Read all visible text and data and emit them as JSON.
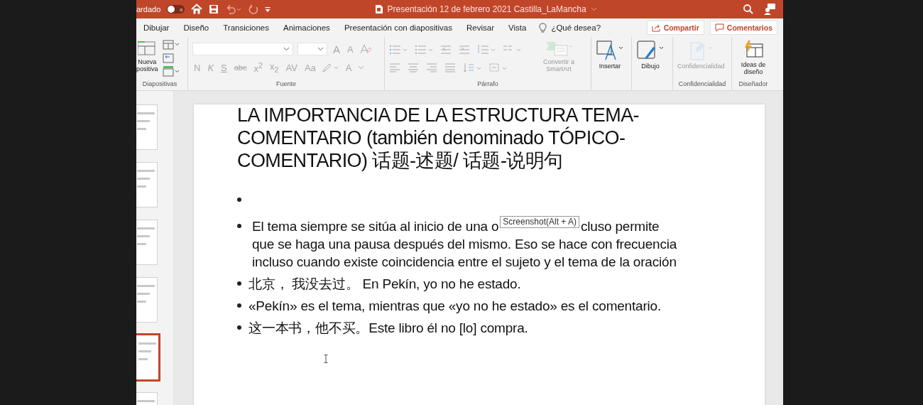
{
  "title_bar": {
    "autosave_label": "ardado",
    "autosave_on": false,
    "autosave_knob": "o",
    "document_title": "Presentación 12 de febrero 2021 Castilla_LaMancha"
  },
  "tabs": [
    {
      "label": "Dibujar",
      "selected": false
    },
    {
      "label": "Diseño",
      "selected": false
    },
    {
      "label": "Transiciones",
      "selected": false
    },
    {
      "label": "Animaciones",
      "selected": false
    },
    {
      "label": "Presentación con diapositivas",
      "selected": false
    },
    {
      "label": "Revisar",
      "selected": false
    },
    {
      "label": "Vista",
      "selected": false
    }
  ],
  "tell_me": {
    "placeholder": "¿Qué desea?"
  },
  "share_button": "Compartir",
  "comments_button": "Comentarios",
  "ribbon": {
    "slides_group": {
      "new_slide": [
        "Nueva",
        "positiva"
      ],
      "label": "Diapositivas"
    },
    "font_group": {
      "format_buttons": [
        "N",
        "K",
        "S",
        "abc",
        "x$^{2}$",
        "x$_{2}$",
        "AV",
        "Aa"
      ],
      "grow": "A",
      "shrink": "A",
      "font_color": "A",
      "label": "Fuente"
    },
    "paragraph_group": {
      "label": "Párrafo",
      "smartart": "Convertir a SmartArt"
    },
    "insert": "Insertar",
    "drawing": "Dibujo",
    "sensitivity": {
      "button": "Confidencialidad",
      "label": "Confidencialidad",
      "disabled": true
    },
    "designer": {
      "button": "Ideas de diseño",
      "label": "Diseñador"
    }
  },
  "thumbnails": [
    {
      "selected": false
    },
    {
      "selected": false
    },
    {
      "selected": false
    },
    {
      "selected": false
    },
    {
      "selected": true
    },
    {
      "selected": false
    }
  ],
  "slide": {
    "title": "LA IMPORTANCIA DE LA ESTRUCTURA TEMA-COMENTARIO (también denominado TÓPICO-COMENTARIO) 话题-述题/ 话题-说明句",
    "bullets": [
      {
        "kind": "empty"
      },
      {
        "kind": "covered",
        "before": "El tema siempre se sitúa al inicio de una o",
        "tooltip": "Screenshot(Alt + A)",
        "after": "cluso permite",
        "continuation": "que se haga una pausa después del mismo. Eso se hace con frecuencia incluso cuando existe coincidencia entre el sujeto y el tema de la oración"
      },
      {
        "kind": "text",
        "text": "北京， 我没去过。 En Pekín, yo no he estado."
      },
      {
        "kind": "text",
        "text": "«Pekín» es el tema, mientras que «yo no he estado» es el comentario."
      },
      {
        "kind": "text",
        "text": "这一本书，他不买。Este libro él no [lo] compra."
      }
    ]
  }
}
